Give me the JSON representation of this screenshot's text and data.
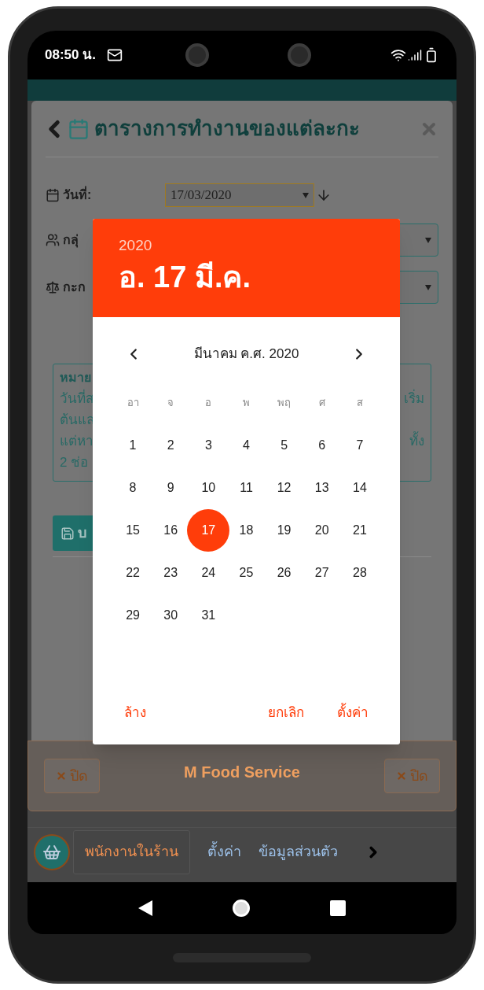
{
  "status_bar": {
    "time": "08:50 น."
  },
  "page": {
    "title": "ตารางการทำงานของแต่ละกะ",
    "fields": [
      {
        "kind": "date",
        "label": "วันที่:",
        "value": "17/03/2020"
      },
      {
        "kind": "group",
        "label": "กลุ่"
      },
      {
        "kind": "shift",
        "label": "กะก"
      }
    ],
    "note": {
      "title": "หมาย",
      "lines": [
        {
          "left": "วันที่ส",
          "right": "เริ่ม"
        },
        {
          "left": "ต้นแล"
        },
        {
          "left": "แต่หา",
          "right": "ทั้ง"
        },
        {
          "left": "2 ช่อ"
        }
      ]
    },
    "save_button": "บ"
  },
  "footer": {
    "close_left": "ปิด",
    "brand": "M Food Service",
    "close_right": "ปิด"
  },
  "bottom_nav": [
    {
      "label": "พนักงานในร้าน",
      "selected": true
    },
    {
      "label": "ตั้งค่า",
      "selected": false
    },
    {
      "label": "ข้อมูลส่วนตัว",
      "selected": false
    }
  ],
  "date_picker": {
    "year": "2020",
    "date": "อ. 17 มี.ค.",
    "month": "มีนาคม ค.ศ. 2020",
    "weekdays": [
      "อา",
      "จ",
      "อ",
      "พ",
      "พฤ",
      "ศ",
      "ส"
    ],
    "days": [
      {
        "label": "1",
        "selected": false
      },
      {
        "label": "2",
        "selected": false
      },
      {
        "label": "3",
        "selected": false
      },
      {
        "label": "4",
        "selected": false
      },
      {
        "label": "5",
        "selected": false
      },
      {
        "label": "6",
        "selected": false
      },
      {
        "label": "7",
        "selected": false
      },
      {
        "label": "8",
        "selected": false
      },
      {
        "label": "9",
        "selected": false
      },
      {
        "label": "10",
        "selected": false
      },
      {
        "label": "11",
        "selected": false
      },
      {
        "label": "12",
        "selected": false
      },
      {
        "label": "13",
        "selected": false
      },
      {
        "label": "14",
        "selected": false
      },
      {
        "label": "15",
        "selected": false
      },
      {
        "label": "16",
        "selected": false
      },
      {
        "label": "17",
        "selected": true
      },
      {
        "label": "18",
        "selected": false
      },
      {
        "label": "19",
        "selected": false
      },
      {
        "label": "20",
        "selected": false
      },
      {
        "label": "21",
        "selected": false
      },
      {
        "label": "22",
        "selected": false
      },
      {
        "label": "23",
        "selected": false
      },
      {
        "label": "24",
        "selected": false
      },
      {
        "label": "25",
        "selected": false
      },
      {
        "label": "26",
        "selected": false
      },
      {
        "label": "27",
        "selected": false
      },
      {
        "label": "28",
        "selected": false
      },
      {
        "label": "29",
        "selected": false
      },
      {
        "label": "30",
        "selected": false
      },
      {
        "label": "31",
        "selected": false
      }
    ],
    "actions": [
      "ล้าง",
      "ยกเลิก",
      "ตั้งค่า"
    ]
  }
}
